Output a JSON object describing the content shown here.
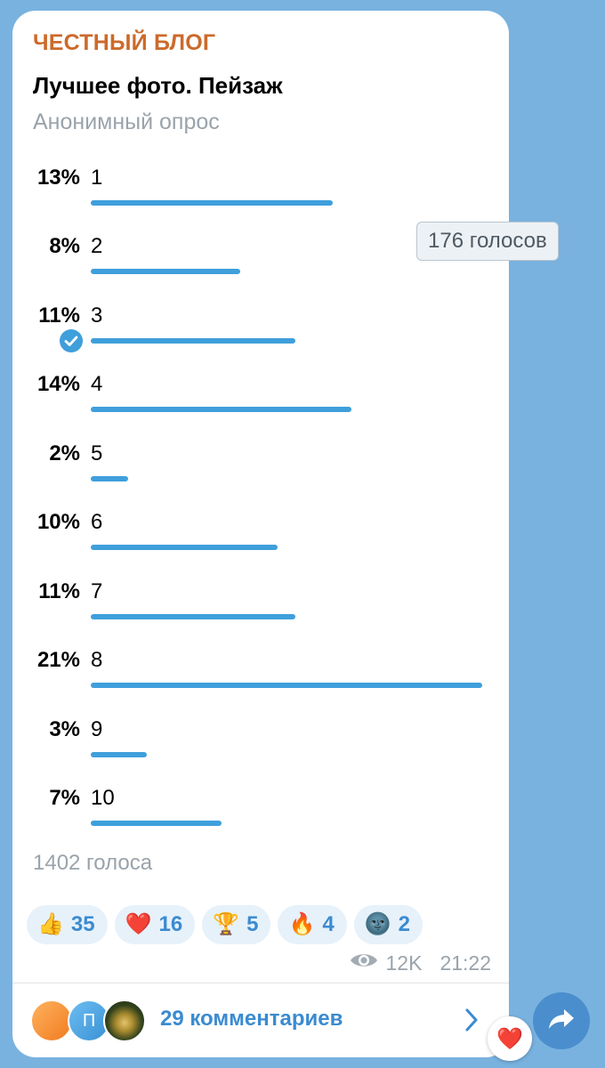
{
  "channel_name": "ЧЕСТНЫЙ БЛОГ",
  "poll": {
    "question": "Лучшее фото. Пейзаж",
    "type_label": "Анонимный опрос",
    "options": [
      {
        "label": "1",
        "percent_text": "13%",
        "percent": 13
      },
      {
        "label": "2",
        "percent_text": "8%",
        "percent": 8
      },
      {
        "label": "3",
        "percent_text": "11%",
        "percent": 11,
        "chosen": true
      },
      {
        "label": "4",
        "percent_text": "14%",
        "percent": 14
      },
      {
        "label": "5",
        "percent_text": "2%",
        "percent": 2
      },
      {
        "label": "6",
        "percent_text": "10%",
        "percent": 10
      },
      {
        "label": "7",
        "percent_text": "11%",
        "percent": 11
      },
      {
        "label": "8",
        "percent_text": "21%",
        "percent": 21
      },
      {
        "label": "9",
        "percent_text": "3%",
        "percent": 3
      },
      {
        "label": "10",
        "percent_text": "7%",
        "percent": 7
      }
    ],
    "total_votes": "1402 голоса",
    "tooltip": "176 голосов"
  },
  "reactions": [
    {
      "emoji": "👍",
      "icon": "thumbs-up-icon",
      "count": "35"
    },
    {
      "emoji": "❤️",
      "icon": "heart-icon",
      "count": "16"
    },
    {
      "emoji": "🏆",
      "icon": "trophy-icon",
      "count": "5"
    },
    {
      "emoji": "🔥",
      "icon": "fire-icon",
      "count": "4"
    },
    {
      "emoji": "🌚",
      "icon": "new-moon-face-icon",
      "count": "2"
    }
  ],
  "meta": {
    "views": "12K",
    "time": "21:22"
  },
  "comments": {
    "avatar2_letter": "П",
    "label": "29 комментариев"
  },
  "heart_badge": "❤️",
  "colors": {
    "accent": "#3f9fdb",
    "channel": "#cc6a2b",
    "background": "#79b2df",
    "link": "#3b8bd0"
  }
}
